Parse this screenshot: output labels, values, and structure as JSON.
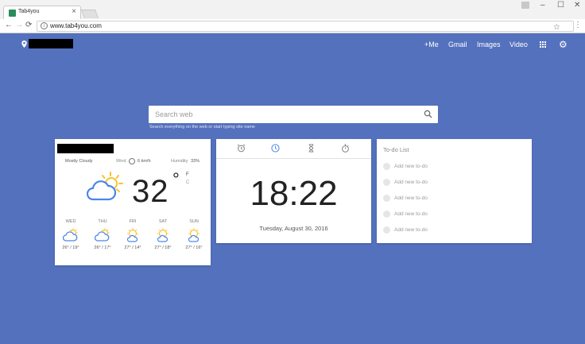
{
  "browser": {
    "tab_title": "Tab4you",
    "tab_close": "×",
    "url": "www.tab4you.com",
    "nav_back": "←",
    "nav_forward": "→",
    "nav_reload": "⟳",
    "star": "☆",
    "menu": "⋮",
    "win_min": "–",
    "win_max": "☐",
    "win_close": "✕"
  },
  "header": {
    "links": [
      "+Me",
      "Gmail",
      "Images",
      "Video"
    ]
  },
  "search": {
    "placeholder": "Search web",
    "hint": "Search everything on the web or start typing site name"
  },
  "weather": {
    "condition": "Mostly Cloudy",
    "wind_label": "Wind",
    "wind_value": "6 km/h",
    "humidity_label": "Humidity",
    "humidity_value": "33%",
    "temperature": "32",
    "degree": "°",
    "unit_f": "F",
    "unit_c": "C",
    "forecast": [
      {
        "day": "WED",
        "temps": "26° / 19°",
        "icon": "cloud-sun-icon"
      },
      {
        "day": "THU",
        "temps": "26° / 17°",
        "icon": "cloud-sun-icon"
      },
      {
        "day": "FRI",
        "temps": "27° / 14°",
        "icon": "sun-cloud-icon"
      },
      {
        "day": "SAT",
        "temps": "27° / 18°",
        "icon": "sun-cloud-icon"
      },
      {
        "day": "SUN",
        "temps": "27° / 16°",
        "icon": "sun-cloud-icon"
      }
    ]
  },
  "clock": {
    "time": "18:22",
    "date": "Tuesday, August 30, 2016",
    "active_tab": "clock"
  },
  "todo": {
    "title": "To-do List",
    "items": [
      "Add new to-do",
      "Add new to-do",
      "Add new to-do",
      "Add new to-do",
      "Add new to-do"
    ]
  },
  "colors": {
    "page_bg": "#5471bd",
    "accent": "#4a86e8",
    "sun": "#f9c22e"
  }
}
